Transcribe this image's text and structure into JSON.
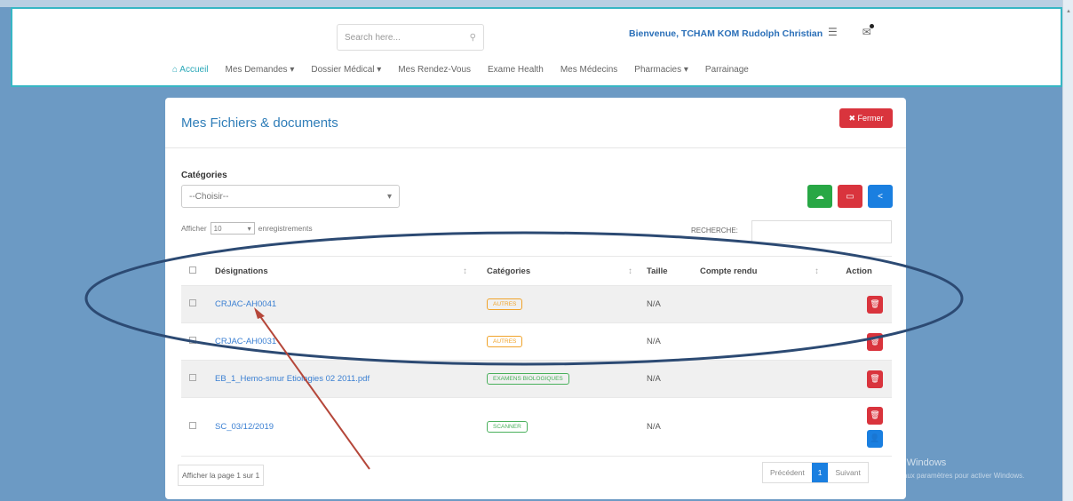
{
  "navbar": {
    "search_placeholder": "Search here...",
    "welcome": "Bienvenue, TCHAM KOM Rudolph Christian",
    "menu": [
      {
        "label": "Accueil",
        "icon": "home-icon"
      },
      {
        "label": "Mes Demandes ▾"
      },
      {
        "label": "Dossier Médical ▾"
      },
      {
        "label": "Mes Rendez-Vous"
      },
      {
        "label": "Exame Health"
      },
      {
        "label": "Mes Médecins"
      },
      {
        "label": "Pharmacies ▾"
      },
      {
        "label": "Parrainage"
      }
    ]
  },
  "card": {
    "title": "Mes Fichiers & documents",
    "close_label": "✖ Fermer",
    "categories_label": "Catégories",
    "categories_value": "--Choisir--",
    "show_prefix": "Afficher",
    "show_value": "10",
    "show_suffix": "enregistrements",
    "search_label": "RECHERCHE:"
  },
  "table": {
    "headers": {
      "designation": "Désignations",
      "categorie": "Catégories",
      "taille": "Taille",
      "compte_rendu": "Compte rendu",
      "action": "Action"
    },
    "rows": [
      {
        "name": "CRJAC-AH0041",
        "category": "AUTRES",
        "size": "N/A"
      },
      {
        "name": "CRJAC-AH0031",
        "category": "AUTRES",
        "size": "N/A"
      },
      {
        "name": "EB_1_Hemo-smur Etiologies 02 2011.pdf",
        "category": "EXAMENS BIOLOGIQUES",
        "size": "N/A"
      },
      {
        "name": "SC_03/12/2019",
        "category": "SCANNER",
        "size": "N/A"
      }
    ]
  },
  "footer": {
    "page_info": "Afficher la page 1 sur 1",
    "prev": "Précédent",
    "current": "1",
    "next": "Suivant"
  },
  "watermark": {
    "title": "Activer Windows",
    "subtitle": "Accédez aux paramètres pour activer Windows."
  },
  "colors": {
    "accent": "#2e7db8",
    "danger": "#d9343d",
    "success": "#28a745",
    "primary": "#1a7fe0",
    "annotation_ellipse": "#2c4a73",
    "annotation_arrow": "#b5473a"
  }
}
